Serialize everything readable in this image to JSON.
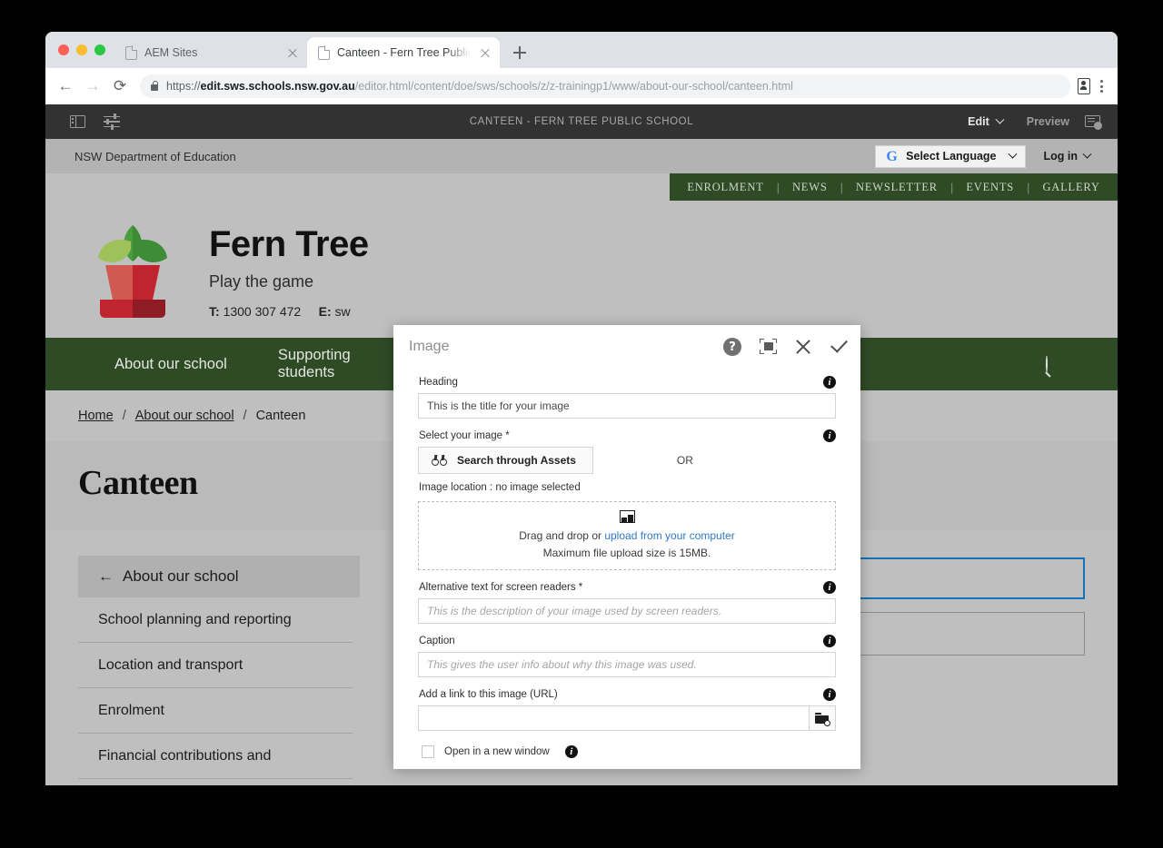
{
  "browser": {
    "tabs": [
      {
        "title": "AEM Sites",
        "active": false
      },
      {
        "title": "Canteen - Fern Tree Public Sch",
        "active": true
      }
    ],
    "url": {
      "scheme": "https://",
      "host": "edit.sws.schools.nsw.gov.au",
      "path": "/editor.html/content/doe/sws/schools/z/z-trainingp1/www/about-our-school/canteen.html"
    },
    "new_tab_label": "+"
  },
  "aem_toolbar": {
    "title": "CANTEEN - FERN TREE PUBLIC SCHOOL",
    "edit_label": "Edit",
    "preview_label": "Preview"
  },
  "dept_bar": {
    "department": "NSW Department of Education",
    "language_select": "Select Language",
    "login": "Log in"
  },
  "utility_nav": [
    "ENROLMENT",
    "NEWS",
    "NEWSLETTER",
    "EVENTS",
    "GALLERY"
  ],
  "masthead": {
    "school_name": "Fern Tree",
    "tagline": "Play the game",
    "phone_label": "T:",
    "phone": "1300 307 472",
    "email_label": "E:",
    "email": "sw"
  },
  "main_nav": [
    "About our school",
    "Supporting students"
  ],
  "breadcrumb": {
    "items": [
      "Home",
      "About our school",
      "Canteen"
    ],
    "separator": "/"
  },
  "page_title": "Canteen",
  "side_nav": {
    "header": "About our school",
    "back_arrow": "←",
    "items": [
      "School planning and reporting",
      "Location and transport",
      "Enrolment",
      "Financial contributions and"
    ]
  },
  "dialog": {
    "title": "Image",
    "heading_label": "Heading",
    "heading_value": "This is the title for your image",
    "select_image_label": "Select your image *",
    "search_assets_button": "Search through Assets",
    "or_label": "OR",
    "image_location": "Image location : no image selected",
    "dropzone": {
      "prefix": "Drag and drop or ",
      "link": "upload from your computer",
      "max_size": "Maximum file upload size is 15MB."
    },
    "alt_label": "Alternative text for screen readers *",
    "alt_placeholder": "This is the description of your image used by screen readers.",
    "caption_label": "Caption",
    "caption_placeholder": "This gives the user info about why this image was used.",
    "url_label": "Add a link to this image (URL)",
    "url_value": "",
    "new_window_label": "Open in a new window",
    "info_glyph": "i"
  },
  "colors": {
    "site_green": "#2e4b26",
    "aem_dark": "#323232",
    "selected_blue": "#1473b5",
    "link_blue": "#2f79c7"
  }
}
